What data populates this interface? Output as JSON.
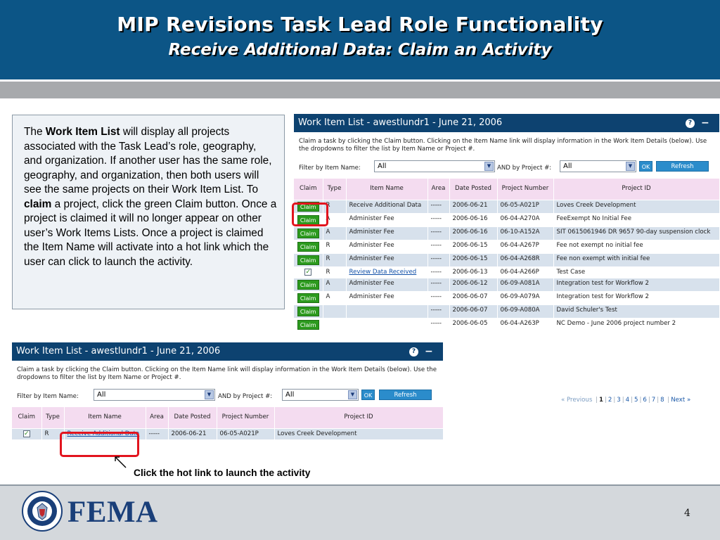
{
  "slide": {
    "title": "MIP Revisions Task Lead Role Functionality",
    "subtitle": "Receive Additional Data:  Claim an Activity",
    "page_number": "4"
  },
  "description": {
    "p1": "The ",
    "b1": "Work Item List",
    "p2": " will display all projects associated with the Task Lead’s role, geography, and organization.  If another user has the same role, geography, and organization, then both users will see the same projects on their Work Item List.  To ",
    "b2": "claim",
    "p3": " a project, click the green Claim button.  Once a project is claimed it will no longer appear on other user’s Work Items Lists.  Once a project is claimed the Item Name will activate into a hot link which the user can click to launch the activity."
  },
  "work_item_list": {
    "title": "Work Item List - awestlundr1 - June 21, 2006",
    "help_glyph": "?",
    "collapse_glyph": "−",
    "instructions": "Claim a task by clicking the Claim button. Clicking on the Item Name link will display information in the Work Item Details (below). Use the dropdowns to filter the list by Item Name or Project #.",
    "filter_item_label": "Filter by Item Name:",
    "filter_item_value": "All",
    "filter_project_label": "AND by Project #:",
    "filter_project_value": "All",
    "ok_label": "OK",
    "refresh_label": "Refresh",
    "claim_label": "Claim",
    "columns": {
      "claim": "Claim",
      "type": "Type",
      "item_name": "Item Name",
      "area": "Area",
      "date_posted": "Date Posted",
      "project_number": "Project Number",
      "project_id": "Project ID"
    },
    "rows": [
      {
        "claimed": false,
        "type": "R",
        "item": "Receive Additional Data",
        "area": "-----",
        "date": "2006-06-21",
        "project": "06-05-A021P",
        "id": "Loves Creek Development"
      },
      {
        "claimed": false,
        "type": "A",
        "item": "Administer Fee",
        "area": "-----",
        "date": "2006-06-16",
        "project": "06-04-A270A",
        "id": "FeeExempt No Initial Fee"
      },
      {
        "claimed": false,
        "type": "A",
        "item": "Administer Fee",
        "area": "-----",
        "date": "2006-06-16",
        "project": "06-10-A152A",
        "id": "SIT 0615061946 DR 9657 90-day suspension clock"
      },
      {
        "claimed": false,
        "type": "R",
        "item": "Administer Fee",
        "area": "-----",
        "date": "2006-06-15",
        "project": "06-04-A267P",
        "id": "Fee not exempt no initial fee"
      },
      {
        "claimed": false,
        "type": "R",
        "item": "Administer Fee",
        "area": "-----",
        "date": "2006-06-15",
        "project": "06-04-A268R",
        "id": "Fee non exempt with initial fee"
      },
      {
        "claimed": true,
        "type": "R",
        "item": "Review Data Received",
        "area": "-----",
        "date": "2006-06-13",
        "project": "06-04-A266P",
        "id": "Test Case"
      },
      {
        "claimed": false,
        "type": "A",
        "item": "Administer Fee",
        "area": "-----",
        "date": "2006-06-12",
        "project": "06-09-A081A",
        "id": "Integration test for Workflow 2"
      },
      {
        "claimed": false,
        "type": "A",
        "item": "Administer Fee",
        "area": "-----",
        "date": "2006-06-07",
        "project": "06-09-A079A",
        "id": "Integration test for Workflow 2"
      },
      {
        "claimed": false,
        "type": "",
        "item": "",
        "area": "-----",
        "date": "2006-06-07",
        "project": "06-09-A080A",
        "id": "David Schuler's Test"
      },
      {
        "claimed": false,
        "type": "",
        "item": "",
        "area": "-----",
        "date": "2006-06-05",
        "project": "06-04-A263P",
        "id": "NC Demo - June 2006 project number 2"
      }
    ],
    "pager": {
      "previous": "« Previous",
      "pages": [
        "1",
        "2",
        "3",
        "4",
        "5",
        "6",
        "7",
        "8"
      ],
      "current": "1",
      "next": "Next »"
    }
  },
  "claimed_list": {
    "row": {
      "claimed": true,
      "type": "R",
      "item": "Receive Additional Data",
      "area": "-----",
      "date": "2006-06-21",
      "project": "06-05-A021P",
      "id": "Loves Creek Development"
    }
  },
  "callout": "Click the hot link to launch the activity",
  "footer": {
    "logo_text": "FEMA"
  },
  "colors": {
    "header_bg": "#0c5586",
    "panel_title_bg": "#0d4270",
    "claim_green": "#2c9a1e",
    "highlight_red": "#e2141e",
    "row_alt": "#d7e1ec",
    "header_row": "#f4dcf0"
  }
}
